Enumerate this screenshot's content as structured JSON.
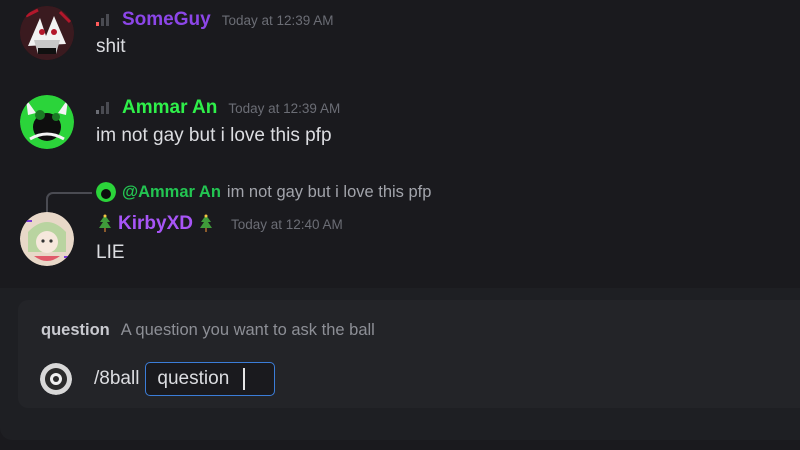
{
  "messages": [
    {
      "username": "SomeGuy",
      "name_color": "#8c46e8",
      "timestamp": "Today at 12:39 AM",
      "content": "shit",
      "avatar": "someguy-avatar"
    },
    {
      "username": "Ammar An",
      "name_color": "#2ff04a",
      "timestamp": "Today at 12:39 AM",
      "content": "im not gay but i love this pfp",
      "avatar": "ammar-avatar"
    },
    {
      "reply_to": {
        "mention": "@Ammar An",
        "text": "im not gay but i love this pfp"
      },
      "username": "KirbyXD",
      "name_color": "#a855f7",
      "timestamp": "Today at 12:40 AM",
      "content": "LIE",
      "avatar": "kirbyxd-avatar"
    }
  ],
  "command": {
    "option_name": "question",
    "option_description": "A question you want to ask the ball",
    "name": "/8ball",
    "field_label": "question"
  },
  "colors": {
    "background": "#1a1a1e",
    "panel": "#232428",
    "focus_border": "#3b7dd8",
    "reply_name": "#23c552"
  }
}
